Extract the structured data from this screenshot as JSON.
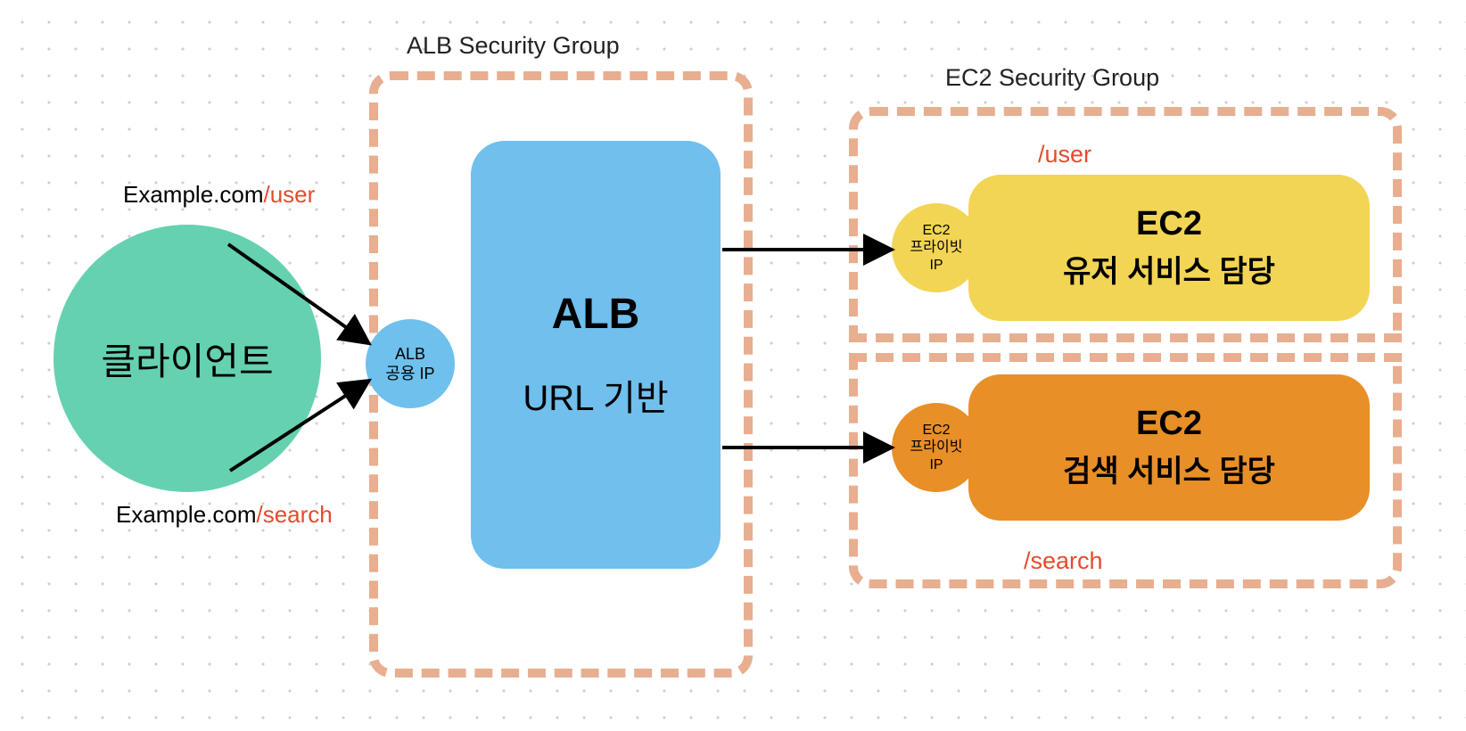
{
  "client": {
    "label": "클라이언트",
    "url_top_prefix": "Example.com",
    "url_top_path": "/user",
    "url_bottom_prefix": "Example.com",
    "url_bottom_path": "/search"
  },
  "alb": {
    "sg_title": "ALB Security Group",
    "ip_label_line1": "ALB",
    "ip_label_line2": "공용 IP",
    "box_line1": "ALB",
    "box_line2": "URL 기반"
  },
  "ec2": {
    "sg_title": "EC2 Security Group",
    "route_user": "/user",
    "route_search": "/search",
    "ip_label_line1": "EC2",
    "ip_label_line2": "프라이빗",
    "ip_label_line3": "IP",
    "user_line1": "EC2",
    "user_line2": "유저 서비스 담당",
    "search_line1": "EC2",
    "search_line2": "검색 서비스 담당"
  },
  "colors": {
    "client": "#65d1b1",
    "alb": "#70bfec",
    "sg_border": "#e8ae90",
    "ec2_user": "#f2d554",
    "ec2_search": "#e88f27",
    "accent_text": "#e34b2e"
  }
}
